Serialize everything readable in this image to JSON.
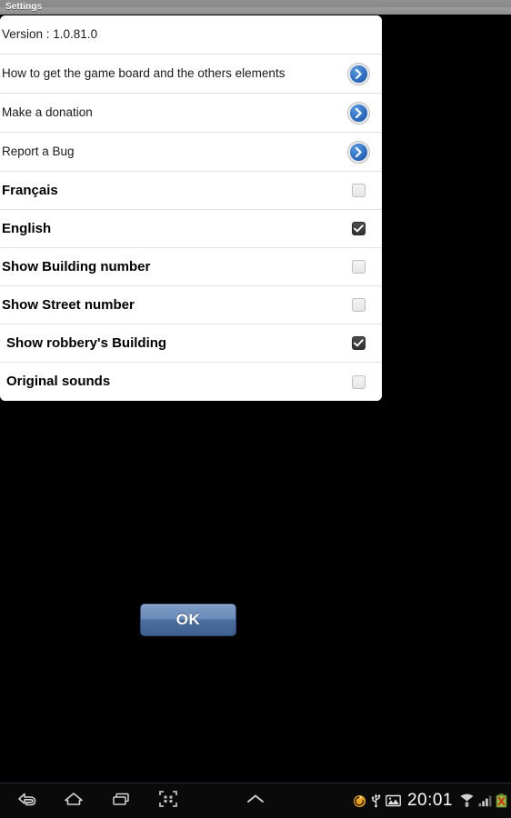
{
  "window": {
    "title": "Settings"
  },
  "dialog": {
    "rows": [
      {
        "type": "version",
        "label": "Version : 1.0.81.0",
        "icon": "none"
      },
      {
        "type": "link",
        "label": "How to get the game board and the others elements",
        "icon": "blue-chevron-right-icon"
      },
      {
        "type": "link",
        "label": "Make a donation",
        "icon": "blue-chevron-right-icon"
      },
      {
        "type": "link",
        "label": "Report a Bug",
        "icon": "blue-chevron-right-icon"
      },
      {
        "type": "checkbox",
        "label": "Français",
        "checked": false,
        "indented": false
      },
      {
        "type": "checkbox",
        "label": "English",
        "checked": true,
        "indented": false
      },
      {
        "type": "checkbox",
        "label": "Show Building number",
        "checked": false,
        "indented": false
      },
      {
        "type": "checkbox",
        "label": "Show Street number",
        "checked": false,
        "indented": false
      },
      {
        "type": "checkbox",
        "label": "Show robbery's Building",
        "checked": true,
        "indented": true
      },
      {
        "type": "checkbox",
        "label": "Original sounds",
        "checked": false,
        "indented": true
      }
    ]
  },
  "actions": {
    "ok_label": "OK"
  },
  "navbar": {
    "buttons": [
      {
        "name": "back-icon",
        "label": "Back"
      },
      {
        "name": "home-icon",
        "label": "Home"
      },
      {
        "name": "recents-icon",
        "label": "Recent apps"
      },
      {
        "name": "screenshot-capture-icon",
        "label": "Capture"
      },
      {
        "name": "chevron-up-icon",
        "label": "Expand"
      }
    ],
    "status": {
      "clock": "20:01",
      "icons": [
        "sync-circle-icon",
        "usb-icon",
        "gallery-image-icon",
        "wifi-icon",
        "cellular-signal-icon",
        "battery-alert-icon"
      ]
    }
  },
  "colors": {
    "accent_blue": "#2f6fc4",
    "button_blue": "#4a6d9e",
    "titlebar_gray": "#909090",
    "panel_white": "#ffffff",
    "backdrop_black": "#000000",
    "checkbox_on": "#333333",
    "status_orange": "#e8a020"
  }
}
